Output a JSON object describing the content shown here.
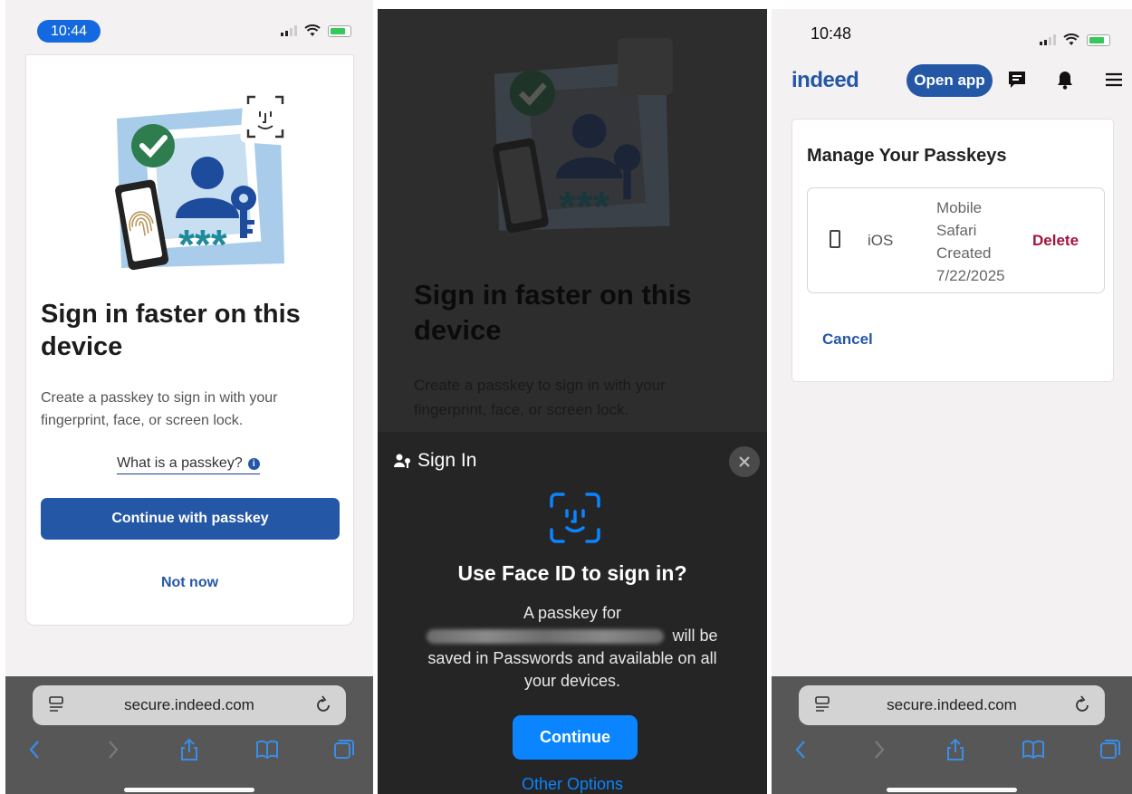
{
  "screen1": {
    "time": "10:44",
    "title": "Sign in faster on this device",
    "description": "Create a passkey to sign in with your fingerprint, face, or screen lock.",
    "what_link": "What is a passkey?",
    "info_glyph": "i",
    "primary_button": "Continue with passkey",
    "secondary_link": "Not now",
    "url": "secure.indeed.com"
  },
  "screen2": {
    "title": "Sign in faster on this device",
    "description": "Create a passkey to sign in with your fingerprint, face, or screen lock.",
    "sheet_header": "Sign In",
    "sheet_title": "Use Face ID to sign in?",
    "body_pre": "A passkey for",
    "body_post": "will be saved in Passwords and available on all your devices.",
    "continue_button": "Continue",
    "other_options": "Other Options"
  },
  "screen3": {
    "time": "10:48",
    "logo": "indeed",
    "open_app": "Open app",
    "card_title": "Manage Your Passkeys",
    "passkey": {
      "platform": "iOS",
      "browser_line1": "Mobile",
      "browser_line2": "Safari",
      "created_label": "Created",
      "created_date": "7/22/2025",
      "delete": "Delete"
    },
    "cancel": "Cancel",
    "url": "secure.indeed.com"
  },
  "colors": {
    "indeed_blue": "#2557a7",
    "ios_blue": "#0a84ff",
    "delete_red": "#a3143d",
    "safari_bar": "#575757"
  },
  "icons": [
    "signal-icon",
    "wifi-icon",
    "battery-icon",
    "checkmark-icon",
    "face-id-icon",
    "fingerprint-icon",
    "person-icon",
    "key-icon",
    "info-icon",
    "tabs-icon",
    "reload-icon",
    "back-icon",
    "forward-icon",
    "share-icon",
    "bookmarks-icon",
    "tabs-overview-icon",
    "close-icon",
    "messages-icon",
    "bell-icon",
    "menu-icon",
    "phone-icon"
  ]
}
